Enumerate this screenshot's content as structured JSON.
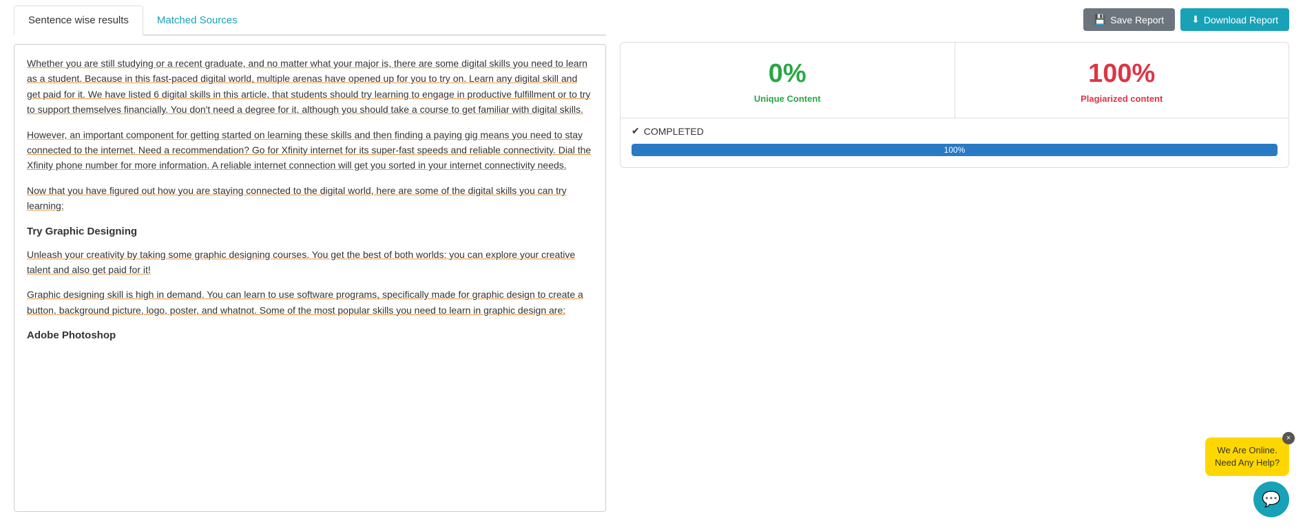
{
  "tabs": {
    "tab1": {
      "label": "Sentence wise results",
      "active": true
    },
    "tab2": {
      "label": "Matched Sources",
      "active": false
    }
  },
  "toolbar": {
    "save_label": "Save Report",
    "download_label": "Download Report",
    "save_icon": "💾",
    "download_icon": "⬇"
  },
  "stats": {
    "unique_percent": "0%",
    "unique_label": "Unique Content",
    "plagiarized_percent": "100%",
    "plagiarized_label": "Plagiarized content",
    "completed_label": "COMPLETED",
    "progress_value": "100%",
    "progress_percent": 100
  },
  "content": {
    "paragraph1": "Whether you are still studying or a recent graduate, and no matter what your major is, there are some digital skills you need to learn as a student. Because in this fast-paced digital world, multiple arenas have opened up for you to try on. Learn any digital skill and get paid for it. We have listed 6 digital skills in this article, that students should try learning to engage in productive fulfillment or to try to support themselves financially. You don't need a degree for it, although you should take a course to get familiar with digital skills.",
    "paragraph2": "However, an important component for getting started on learning these skills and then finding a paying gig means you need to stay connected to the internet. Need a recommendation?  Go for Xfinity internet for its super-fast speeds and reliable connectivity. Dial the Xfinity phone number for more information. A reliable internet connection will get you sorted in your internet connectivity needs.",
    "paragraph3": "Now that you have figured out how you are staying connected to the digital world, here are some of the digital skills you can try learning:",
    "heading1": "Try Graphic Designing",
    "paragraph4": "Unleash your creativity by taking some graphic designing courses. You get the best of both worlds: you can explore your creative talent and also get paid for it!",
    "paragraph5": "Graphic designing skill is high in demand. You can learn to use software programs, specifically made for graphic design to create a button, background picture, logo, poster, and whatnot. Some of the most popular skills you need to learn in graphic design are:",
    "heading2": "Adobe Photoshop"
  },
  "chat": {
    "bubble_line1": "We Are Online.",
    "bubble_line2": "Need Any Help?",
    "close_label": "×"
  }
}
